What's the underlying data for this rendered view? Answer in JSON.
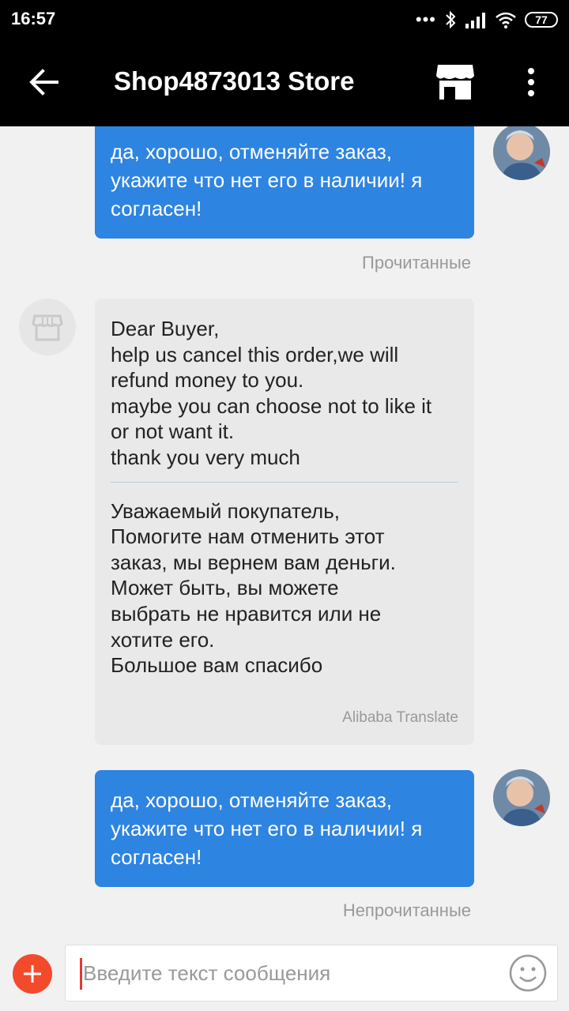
{
  "status_bar": {
    "time": "16:57",
    "signal_dots": "•••",
    "battery": "77"
  },
  "app_bar": {
    "title": "Shop4873013 Store",
    "icons": [
      "back-arrow-icon",
      "store-icon",
      "more-vert-icon"
    ]
  },
  "messages": [
    {
      "direction": "outgoing",
      "text": "да, хорошо, отменяйте заказ,\nукажите что нет его в наличии! я\nсогласен!",
      "status": "Прочитанные"
    },
    {
      "direction": "incoming",
      "original": "Dear Buyer,\nhelp us cancel this order,we will\nrefund money to you.\nmaybe you can choose not to like it\nor not want it.\nthank you very much",
      "translation": "Уважаемый покупатель,\nПомогите нам отменить этот\nзаказ, мы вернем вам деньги.\nМожет быть, вы можете\nвыбрать не нравится или не\nхотите его.\nБольшое вам спасибо",
      "credit": "Alibaba Translate"
    },
    {
      "direction": "outgoing",
      "text": "да, хорошо, отменяйте заказ,\nукажите что нет его в наличии! я\nсогласен!",
      "status": "Непрочитанные"
    }
  ],
  "input": {
    "placeholder": "Введите текст сообщения"
  },
  "colors": {
    "outgoing_bubble": "#2e84e1",
    "incoming_bubble": "#e9e9e9",
    "accent_add": "#f34a2c",
    "app_bar": "#000000"
  }
}
